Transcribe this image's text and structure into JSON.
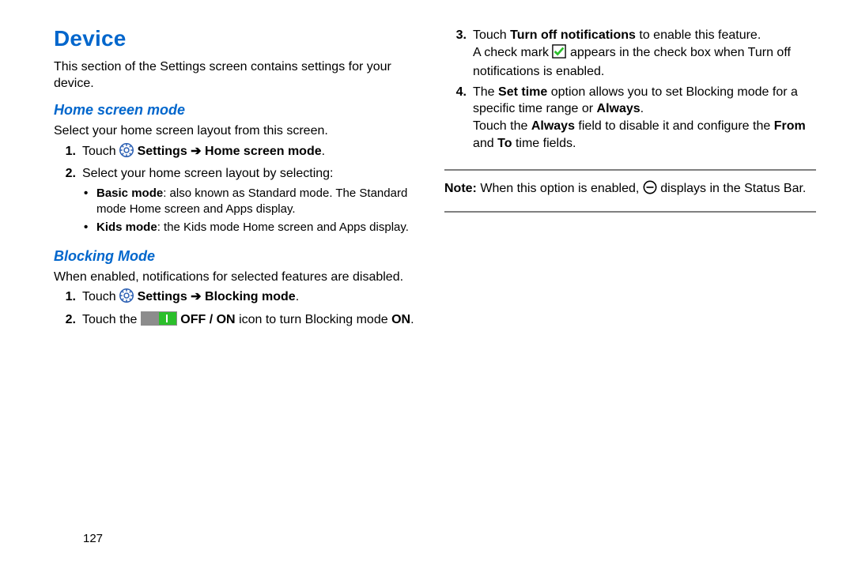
{
  "title": "Device",
  "intro": "This section of the Settings screen contains settings for your device.",
  "home": {
    "heading": "Home screen mode",
    "lead": "Select your home screen layout from this screen.",
    "step1_prefix": "Touch ",
    "step1_label": "Settings",
    "step1_arrow": " ➔ ",
    "step1_target": "Home screen mode",
    "step2": "Select your home screen layout by selecting:",
    "bullet1_lead": "Basic mode",
    "bullet1_rest": ": also known as Standard mode. The Standard mode Home screen and Apps display.",
    "bullet2_lead": "Kids mode",
    "bullet2_rest": ": the Kids mode Home screen and Apps display."
  },
  "blocking": {
    "heading": "Blocking Mode",
    "lead": "When enabled, notifications for selected features are disabled.",
    "step1_prefix": "Touch ",
    "step1_label": "Settings",
    "step1_arrow": " ➔ ",
    "step1_target": "Blocking mode",
    "step2_a": "Touch the ",
    "step2_b": "OFF / ON",
    "step2_c": " icon to turn Blocking mode ",
    "step2_d": "ON"
  },
  "right": {
    "step3_a": "Touch ",
    "step3_b": "Turn off notifications",
    "step3_c": " to enable this feature.",
    "step3_followup_a": "A check mark ",
    "step3_followup_b": " appears in the check box when Turn off notifications is enabled.",
    "step4_a": "The ",
    "step4_b": "Set time",
    "step4_c": " option allows you to set Blocking mode for a specific time range or ",
    "step4_d": "Always",
    "step4_followup_a": "Touch the ",
    "step4_followup_b": "Always",
    "step4_followup_c": " field to disable it and configure the ",
    "step4_followup_d": "From",
    "step4_followup_e": " and ",
    "step4_followup_f": "To",
    "step4_followup_g": " time fields.",
    "note_label": "Note:",
    "note_a": " When this option is enabled, ",
    "note_b": " displays in the Status Bar."
  },
  "page_number": "127"
}
